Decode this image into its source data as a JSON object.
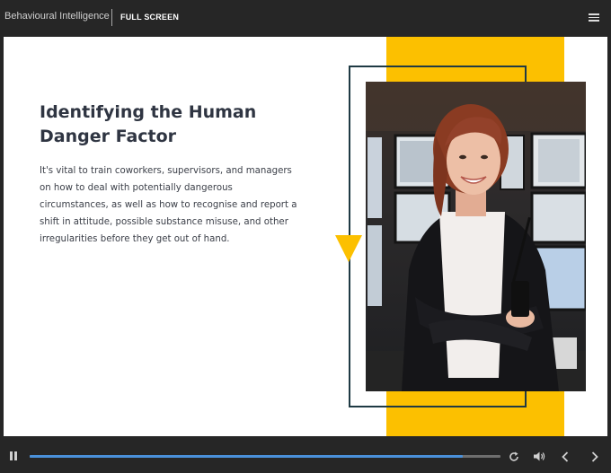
{
  "header": {
    "app_title": "Behavioural Intelligence",
    "fullscreen_label": "FULL SCREEN",
    "menu_icon": "hamburger-menu-icon"
  },
  "slide": {
    "title": "Identifying the Human Danger Factor",
    "body": "It's vital to train coworkers, supervisors, and managers on how to deal with potentially dangerous circumstances, as well as how to recognise and report a shift in attitude, possible substance misuse, and other irregularities before they get out of hand.",
    "photo": "smiling woman in black blazer holding walkie-talkie in front of security monitors",
    "accent_color": "#fcc000",
    "frame_color": "#1f3a44"
  },
  "controls": {
    "play_state_icon": "pause-icon",
    "progress": 0.92,
    "progress_color": "#4a90d9",
    "icons": [
      "replay-icon",
      "volume-icon",
      "previous-icon",
      "next-icon"
    ]
  }
}
